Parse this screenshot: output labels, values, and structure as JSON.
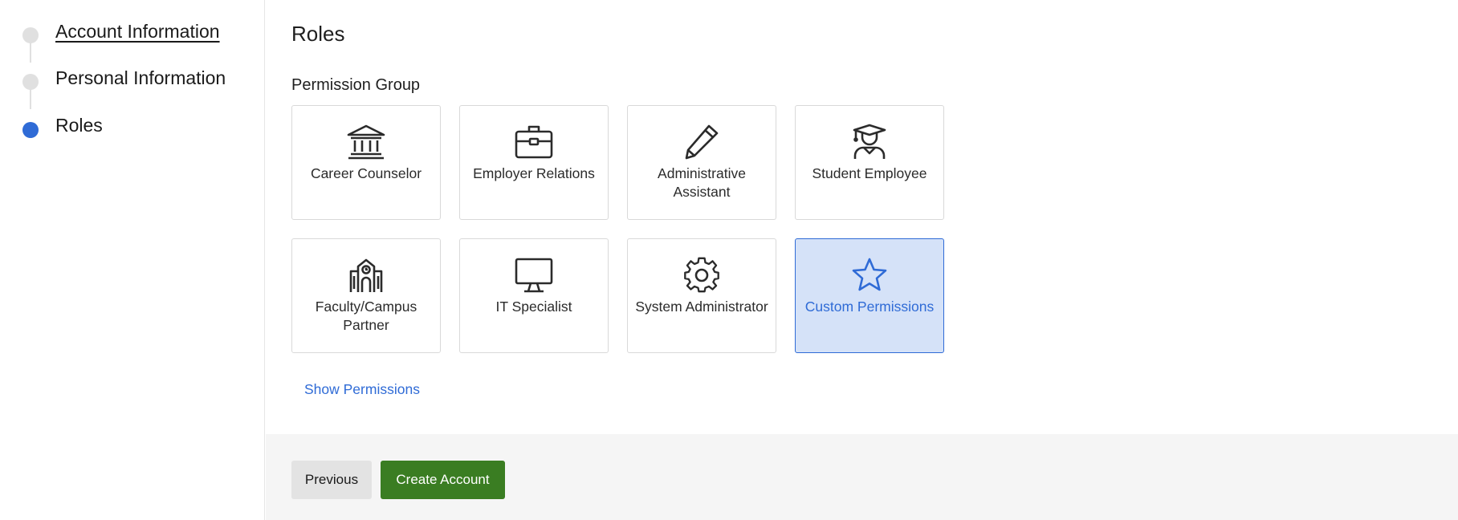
{
  "sidebar": {
    "steps": [
      {
        "label": "Account Information",
        "state": "complete"
      },
      {
        "label": "Personal Information",
        "state": "complete"
      },
      {
        "label": "Roles",
        "state": "active"
      }
    ]
  },
  "main": {
    "title": "Roles",
    "section_title": "Permission Group",
    "cards": [
      {
        "label": "Career Counselor",
        "icon": "bank-icon",
        "selected": false
      },
      {
        "label": "Employer Relations",
        "icon": "briefcase-icon",
        "selected": false
      },
      {
        "label": "Administrative Assistant",
        "icon": "pencil-icon",
        "selected": false
      },
      {
        "label": "Student Employee",
        "icon": "graduate-icon",
        "selected": false
      },
      {
        "label": "Faculty/Campus Partner",
        "icon": "school-building-icon",
        "selected": false
      },
      {
        "label": "IT Specialist",
        "icon": "monitor-icon",
        "selected": false
      },
      {
        "label": "System Administrator",
        "icon": "gear-icon",
        "selected": false
      },
      {
        "label": "Custom Permissions",
        "icon": "star-icon",
        "selected": true
      }
    ],
    "show_permissions_label": "Show Permissions"
  },
  "footer": {
    "previous_label": "Previous",
    "create_label": "Create Account"
  },
  "colors": {
    "accent": "#2f6bd6",
    "selected_bg": "#d5e2f8",
    "primary_button": "#3a7d22",
    "step_inactive": "#e0e0e0"
  }
}
